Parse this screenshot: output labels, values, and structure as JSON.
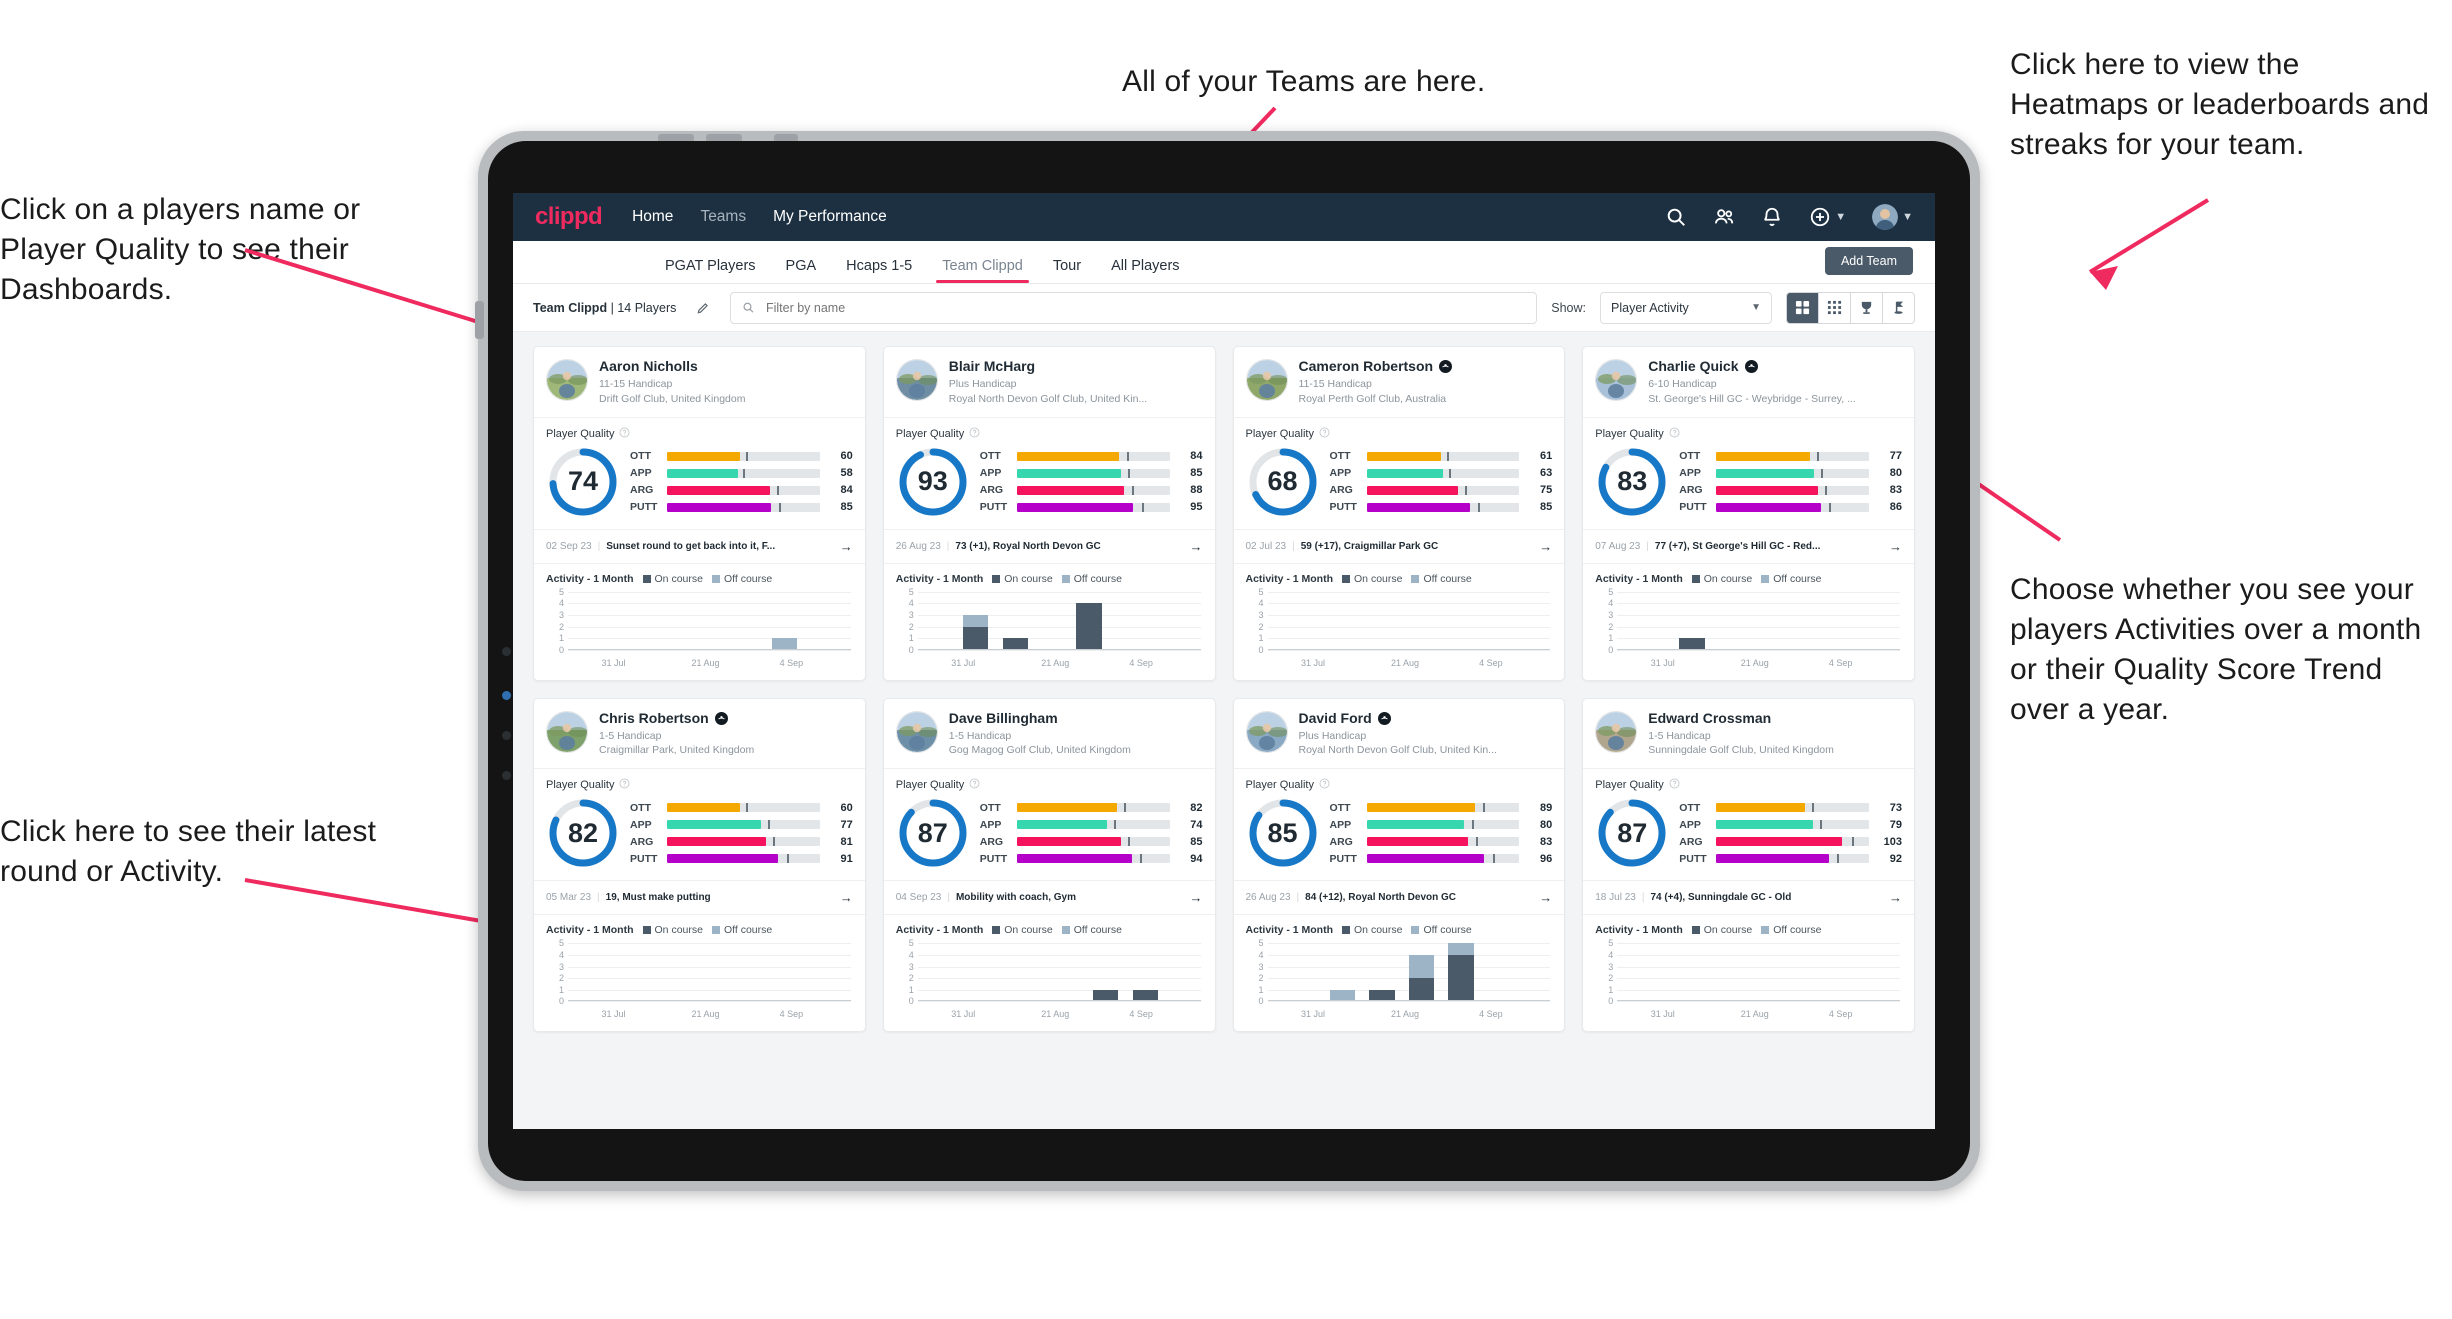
{
  "annotations": [
    {
      "id": "teams",
      "text": "All of your Teams are here."
    },
    {
      "id": "heatmaps",
      "text": "Click here to view the Heatmaps or leaderboards and streaks for your team."
    },
    {
      "id": "names",
      "text": "Click on a players name or Player Quality to see their Dashboards."
    },
    {
      "id": "activity",
      "text": "Choose whether you see your players Activities over a month or their Quality Score Trend over a year."
    },
    {
      "id": "latest",
      "text": "Click here to see their latest round or Activity."
    }
  ],
  "app": {
    "logo": "clippd",
    "nav": [
      {
        "label": "Home",
        "active": true
      },
      {
        "label": "Teams",
        "active": false
      },
      {
        "label": "My Performance",
        "active": true
      }
    ],
    "header_icons": [
      "search-icon",
      "people-icon",
      "bell-icon",
      "plus-circle-icon",
      "avatar"
    ],
    "tabs": [
      {
        "label": "PGAT Players",
        "active": false
      },
      {
        "label": "PGA",
        "active": false
      },
      {
        "label": "Hcaps 1-5",
        "active": false
      },
      {
        "label": "Team Clippd",
        "active": true
      },
      {
        "label": "Tour",
        "active": false
      },
      {
        "label": "All Players",
        "active": false
      }
    ],
    "add_team_label": "Add Team",
    "toolbar": {
      "team_name": "Team Clippd",
      "team_separator": "|",
      "player_count": "14 Players",
      "edit_icon": "pencil-icon",
      "search_placeholder": "Filter by name",
      "search_value": "",
      "show_label": "Show:",
      "show_value": "Player Activity",
      "show_options": [
        "Player Activity",
        "Quality Score Trend"
      ],
      "view_toggles": [
        {
          "name": "cards-view",
          "active": true
        },
        {
          "name": "grid-view",
          "active": false
        },
        {
          "name": "leaderboard-trophy-view",
          "active": false
        },
        {
          "name": "heatmap-flag-view",
          "active": false
        }
      ]
    }
  },
  "quality_colors": {
    "ott": "#f5a800",
    "app": "#36d6ae",
    "arg": "#f4135c",
    "putt": "#b400c8",
    "ring": "#1778c7",
    "ring_bg": "#e2e5e8",
    "on_course": "#4a5a68",
    "off_course": "#9db4c6"
  },
  "activity": {
    "title": "Activity - 1 Month",
    "legend": [
      "On course",
      "Off course"
    ],
    "y_ticks": [
      5,
      4,
      3,
      2,
      1,
      0
    ],
    "x_ticks": [
      "31 Jul",
      "21 Aug",
      "4 Sep"
    ]
  },
  "players": [
    {
      "name": "Aaron Nicholls",
      "verified": false,
      "handicap": "11-15 Handicap",
      "club": "Drift Golf Club, United Kingdom",
      "quality_label": "Player Quality",
      "score": 74,
      "metrics": [
        {
          "key": "OTT",
          "value": 60
        },
        {
          "key": "APP",
          "value": 58
        },
        {
          "key": "ARG",
          "value": 84
        },
        {
          "key": "PUTT",
          "value": 85
        }
      ],
      "round_date": "02 Sep 23",
      "round_text": "Sunset round to get back into it, F...",
      "chart": {
        "bars": [
          {
            "x": 72,
            "on": 0,
            "off": 1
          }
        ]
      }
    },
    {
      "name": "Blair McHarg",
      "verified": false,
      "handicap": "Plus Handicap",
      "club": "Royal North Devon Golf Club, United Kin...",
      "quality_label": "Player Quality",
      "score": 93,
      "metrics": [
        {
          "key": "OTT",
          "value": 84
        },
        {
          "key": "APP",
          "value": 85
        },
        {
          "key": "ARG",
          "value": 88
        },
        {
          "key": "PUTT",
          "value": 95
        }
      ],
      "round_date": "26 Aug 23",
      "round_text": "73 (+1), Royal North Devon GC",
      "chart": {
        "bars": [
          {
            "x": 16,
            "on": 2,
            "off": 1
          },
          {
            "x": 30,
            "on": 1,
            "off": 0
          },
          {
            "x": 56,
            "on": 4,
            "off": 0
          }
        ]
      }
    },
    {
      "name": "Cameron Robertson",
      "verified": true,
      "handicap": "11-15 Handicap",
      "club": "Royal Perth Golf Club, Australia",
      "quality_label": "Player Quality",
      "score": 68,
      "metrics": [
        {
          "key": "OTT",
          "value": 61
        },
        {
          "key": "APP",
          "value": 63
        },
        {
          "key": "ARG",
          "value": 75
        },
        {
          "key": "PUTT",
          "value": 85
        }
      ],
      "round_date": "02 Jul 23",
      "round_text": "59 (+17), Craigmillar Park GC",
      "chart": {
        "bars": []
      }
    },
    {
      "name": "Charlie Quick",
      "verified": true,
      "handicap": "6-10 Handicap",
      "club": "St. George's Hill GC - Weybridge - Surrey, ...",
      "quality_label": "Player Quality",
      "score": 83,
      "metrics": [
        {
          "key": "OTT",
          "value": 77
        },
        {
          "key": "APP",
          "value": 80
        },
        {
          "key": "ARG",
          "value": 83
        },
        {
          "key": "PUTT",
          "value": 86
        }
      ],
      "round_date": "07 Aug 23",
      "round_text": "77 (+7), St George's Hill GC - Red...",
      "chart": {
        "bars": [
          {
            "x": 22,
            "on": 1,
            "off": 0
          }
        ]
      }
    },
    {
      "name": "Chris Robertson",
      "verified": true,
      "handicap": "1-5 Handicap",
      "club": "Craigmillar Park, United Kingdom",
      "quality_label": "Player Quality",
      "score": 82,
      "metrics": [
        {
          "key": "OTT",
          "value": 60
        },
        {
          "key": "APP",
          "value": 77
        },
        {
          "key": "ARG",
          "value": 81
        },
        {
          "key": "PUTT",
          "value": 91
        }
      ],
      "round_date": "05 Mar 23",
      "round_text": "19, Must make putting",
      "chart": {
        "bars": []
      }
    },
    {
      "name": "Dave Billingham",
      "verified": false,
      "handicap": "1-5 Handicap",
      "club": "Gog Magog Golf Club, United Kingdom",
      "quality_label": "Player Quality",
      "score": 87,
      "metrics": [
        {
          "key": "OTT",
          "value": 82
        },
        {
          "key": "APP",
          "value": 74
        },
        {
          "key": "ARG",
          "value": 85
        },
        {
          "key": "PUTT",
          "value": 94
        }
      ],
      "round_date": "04 Sep 23",
      "round_text": "Mobility with coach, Gym",
      "chart": {
        "bars": [
          {
            "x": 62,
            "on": 1,
            "off": 0
          },
          {
            "x": 76,
            "on": 1,
            "off": 0
          }
        ]
      }
    },
    {
      "name": "David Ford",
      "verified": true,
      "handicap": "Plus Handicap",
      "club": "Royal North Devon Golf Club, United Kin...",
      "quality_label": "Player Quality",
      "score": 85,
      "metrics": [
        {
          "key": "OTT",
          "value": 89
        },
        {
          "key": "APP",
          "value": 80
        },
        {
          "key": "ARG",
          "value": 83
        },
        {
          "key": "PUTT",
          "value": 96
        }
      ],
      "round_date": "26 Aug 23",
      "round_text": "84 (+12), Royal North Devon GC",
      "chart": {
        "bars": [
          {
            "x": 22,
            "on": 0,
            "off": 1
          },
          {
            "x": 36,
            "on": 1,
            "off": 0
          },
          {
            "x": 50,
            "on": 2,
            "off": 2
          },
          {
            "x": 64,
            "on": 4,
            "off": 1
          }
        ]
      }
    },
    {
      "name": "Edward Crossman",
      "verified": false,
      "handicap": "1-5 Handicap",
      "club": "Sunningdale Golf Club, United Kingdom",
      "quality_label": "Player Quality",
      "score": 87,
      "metrics": [
        {
          "key": "OTT",
          "value": 73
        },
        {
          "key": "APP",
          "value": 79
        },
        {
          "key": "ARG",
          "value": 103
        },
        {
          "key": "PUTT",
          "value": 92
        }
      ],
      "round_date": "18 Jul 23",
      "round_text": "74 (+4), Sunningdale GC - Old",
      "chart": {
        "bars": []
      }
    }
  ]
}
